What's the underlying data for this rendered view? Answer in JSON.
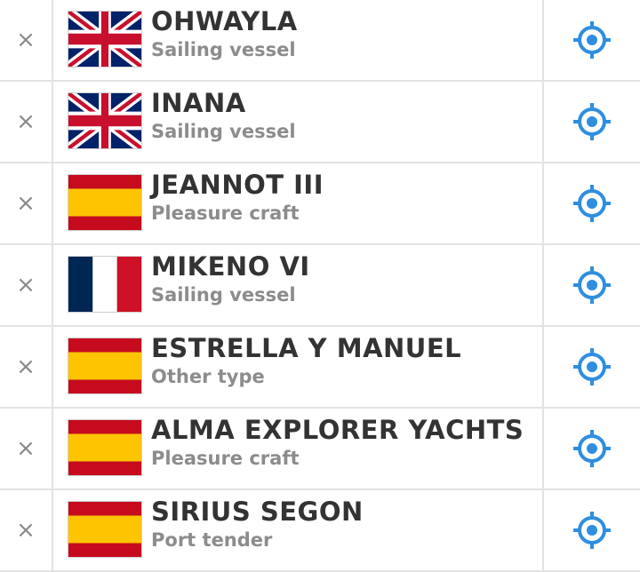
{
  "remove_symbol": "×",
  "accent_color": "#2f8ee0",
  "vessels": [
    {
      "name": "OHWAYLA",
      "type": "Sailing vessel",
      "flag": "united-kingdom"
    },
    {
      "name": "INANA",
      "type": "Sailing vessel",
      "flag": "united-kingdom"
    },
    {
      "name": "JEANNOT III",
      "type": "Pleasure craft",
      "flag": "spain"
    },
    {
      "name": "MIKENO VI",
      "type": "Sailing vessel",
      "flag": "france"
    },
    {
      "name": "ESTRELLA Y MANUEL",
      "type": "Other type",
      "flag": "spain"
    },
    {
      "name": "ALMA EXPLORER YACHTS",
      "type": "Pleasure craft",
      "flag": "spain"
    },
    {
      "name": "SIRIUS SEGON",
      "type": "Port tender",
      "flag": "spain"
    }
  ]
}
